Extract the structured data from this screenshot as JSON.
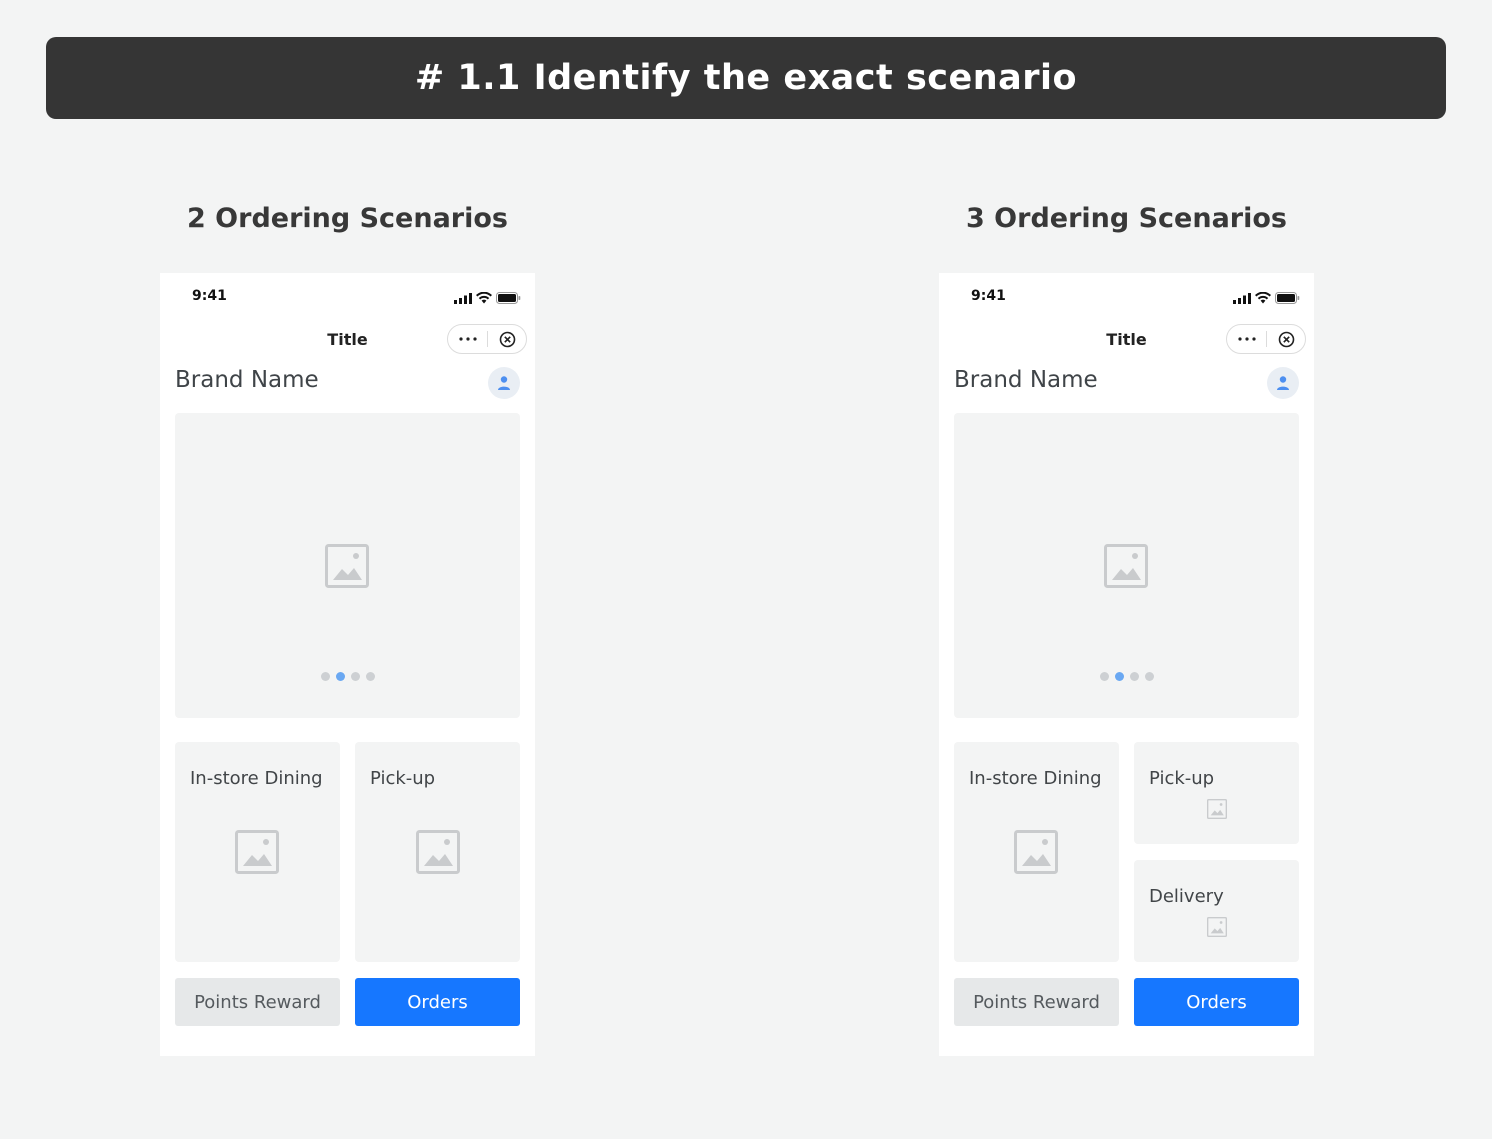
{
  "header": {
    "title": "# 1.1  Identify the exact scenario"
  },
  "columns": [
    {
      "heading": "2 Ordering Scenarios",
      "phone": {
        "time": "9:41",
        "nav_title": "Title",
        "brand_name": "Brand Name",
        "carousel": {
          "pages": 4,
          "active_index": 1
        },
        "cards": [
          "In-store Dining",
          "Pick-up"
        ],
        "buttons": {
          "points": "Points Reward",
          "orders": "Orders"
        }
      }
    },
    {
      "heading": "3 Ordering Scenarios",
      "phone": {
        "time": "9:41",
        "nav_title": "Title",
        "brand_name": "Brand Name",
        "carousel": {
          "pages": 4,
          "active_index": 1
        },
        "cards": [
          "In-store Dining",
          "Pick-up",
          "Delivery"
        ],
        "buttons": {
          "points": "Points Reward",
          "orders": "Orders"
        }
      }
    }
  ],
  "colors": {
    "primary": "#1677ff",
    "banner_bg": "#353535",
    "page_bg": "#f3f4f4",
    "dot_active": "#6aa8f2"
  },
  "icons": [
    "signal-icon",
    "wifi-icon",
    "battery-icon",
    "more-icon",
    "close-icon",
    "user-icon",
    "image-placeholder-icon"
  ]
}
